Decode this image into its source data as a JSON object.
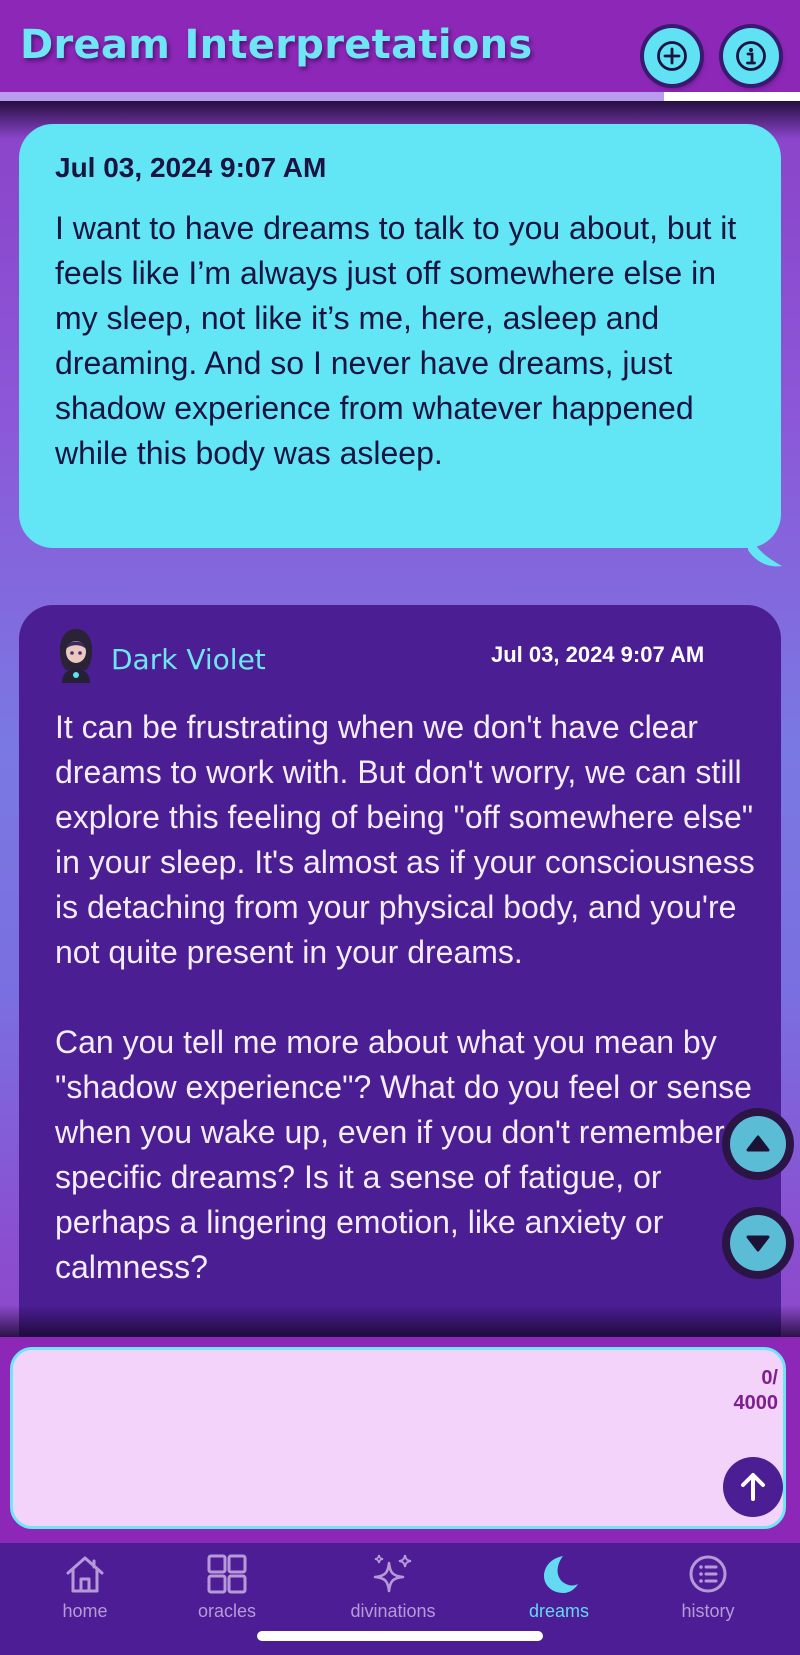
{
  "header": {
    "title": "Dream Interpretations",
    "add_icon": "plus-circle-icon",
    "info_icon": "info-icon"
  },
  "progress": {
    "value": 0.83
  },
  "conversation": {
    "user_message": {
      "timestamp": "Jul 03, 2024 9:07 AM",
      "text": "I want to have dreams to talk to you about, but it feels like I’m always just off somewhere else in my sleep, not like it’s me, here, asleep and dreaming. And so I never have dreams, just shadow experience from whatever happened while this body was asleep."
    },
    "bot_message": {
      "name": "Dark Violet",
      "timestamp": "Jul 03, 2024 9:07 AM",
      "text": "It can be frustrating when we don't have clear dreams to work with. But don't worry, we can still explore this feeling of being \"off somewhere else\" in your sleep. It's almost as if your consciousness is detaching from your physical body, and you're not quite present in your dreams.\n\nCan you tell me more about what you mean by \"shadow experience\"? What do you feel or sense when you wake up, even if you don't remember specific dreams? Is it a sense of fatigue, or perhaps a lingering emotion, like anxiety or calmness?"
    }
  },
  "scroll": {
    "up_icon": "chevron-up-icon",
    "down_icon": "chevron-down-icon"
  },
  "composer": {
    "value": "",
    "counter_current": "0/",
    "counter_max": "4000",
    "send_icon": "arrow-up-icon"
  },
  "tabs": [
    {
      "label": "home",
      "icon": "home-icon"
    },
    {
      "label": "oracles",
      "icon": "grid-icon"
    },
    {
      "label": "divinations",
      "icon": "sparkles-icon"
    },
    {
      "label": "dreams",
      "icon": "moon-icon",
      "active": true
    },
    {
      "label": "history",
      "icon": "list-icon"
    }
  ],
  "colors": {
    "accent": "#62e5f5",
    "header": "#8d27b7",
    "bot_bubble": "#4c1e93",
    "tab_active": "#63d9f2",
    "tab_inactive": "#b69ad8"
  }
}
